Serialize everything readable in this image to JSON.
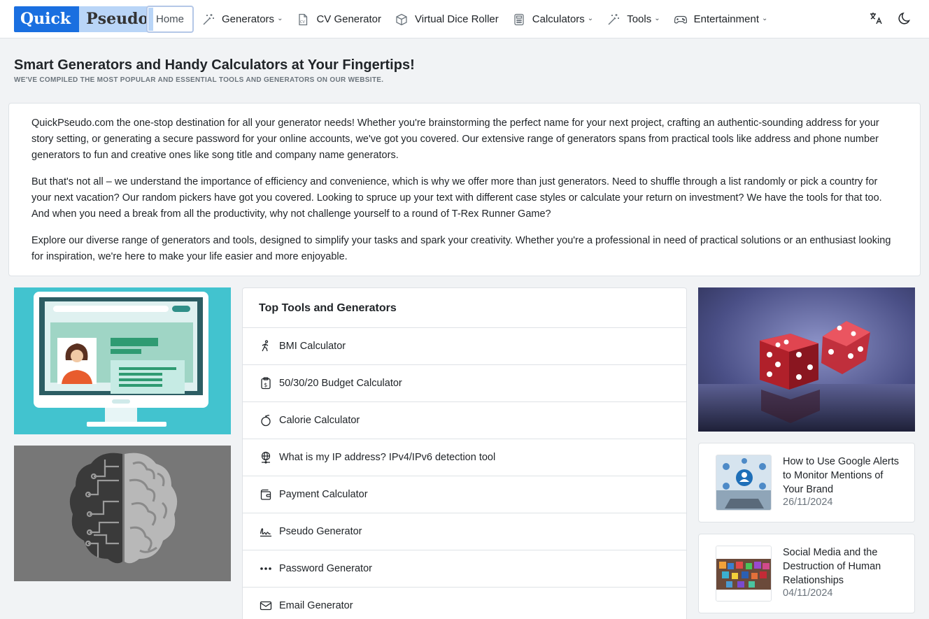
{
  "brand": {
    "part1": "Quick",
    "part2": "Pseudo"
  },
  "nav": {
    "home": "Home",
    "generators": "Generators",
    "cv": "CV Generator",
    "dice": "Virtual Dice Roller",
    "calculators": "Calculators",
    "tools": "Tools",
    "entertainment": "Entertainment"
  },
  "header": {
    "title": "Smart Generators and Handy Calculators at Your Fingertips!",
    "subtitle": "We've compiled the most popular and essential tools and generators on our website."
  },
  "intro": {
    "p1": "QuickPseudo.com the one-stop destination for all your generator needs! Whether you're brainstorming the perfect name for your next project, crafting an authentic-sounding address for your story setting, or generating a secure password for your online accounts, we've got you covered. Our extensive range of generators spans from practical tools like address and phone number generators to fun and creative ones like song title and company name generators.",
    "p2": "But that's not all – we understand the importance of efficiency and convenience, which is why we offer more than just generators. Need to shuffle through a list randomly or pick a country for your next vacation? Our random pickers have got you covered. Looking to spruce up your text with different case styles or calculate your return on investment? We have the tools for that too. And when you need a break from all the productivity, why not challenge yourself to a round of T-Rex Runner Game?",
    "p3": "Explore our diverse range of generators and tools, designed to simplify your tasks and spark your creativity. Whether you're a professional in need of practical solutions or an enthusiast looking for inspiration, we're here to make your life easier and more enjoyable."
  },
  "top_tools": {
    "title": "Top Tools and Generators",
    "items": [
      {
        "label": "BMI Calculator",
        "icon": "person-walking-icon"
      },
      {
        "label": "50/30/20 Budget Calculator",
        "icon": "budget-receipt-icon"
      },
      {
        "label": "Calorie Calculator",
        "icon": "apple-icon"
      },
      {
        "label": "What is my IP address? IPv4/IPv6 detection tool",
        "icon": "globe-network-icon"
      },
      {
        "label": "Payment Calculator",
        "icon": "wallet-icon"
      },
      {
        "label": "Pseudo Generator",
        "icon": "signature-icon"
      },
      {
        "label": "Password Generator",
        "icon": "dots-icon"
      },
      {
        "label": "Email Generator",
        "icon": "envelope-icon"
      }
    ]
  },
  "posts": [
    {
      "title": "How to Use Google Alerts to Monitor Mentions of Your Brand",
      "date": "26/11/2024"
    },
    {
      "title": "Social Media and the Destruction of Human Relationships",
      "date": "04/11/2024"
    }
  ],
  "colors": {
    "brand_blue": "#1a6fe0",
    "brand_light": "#b9d5f7",
    "teal": "#42c3cf"
  }
}
